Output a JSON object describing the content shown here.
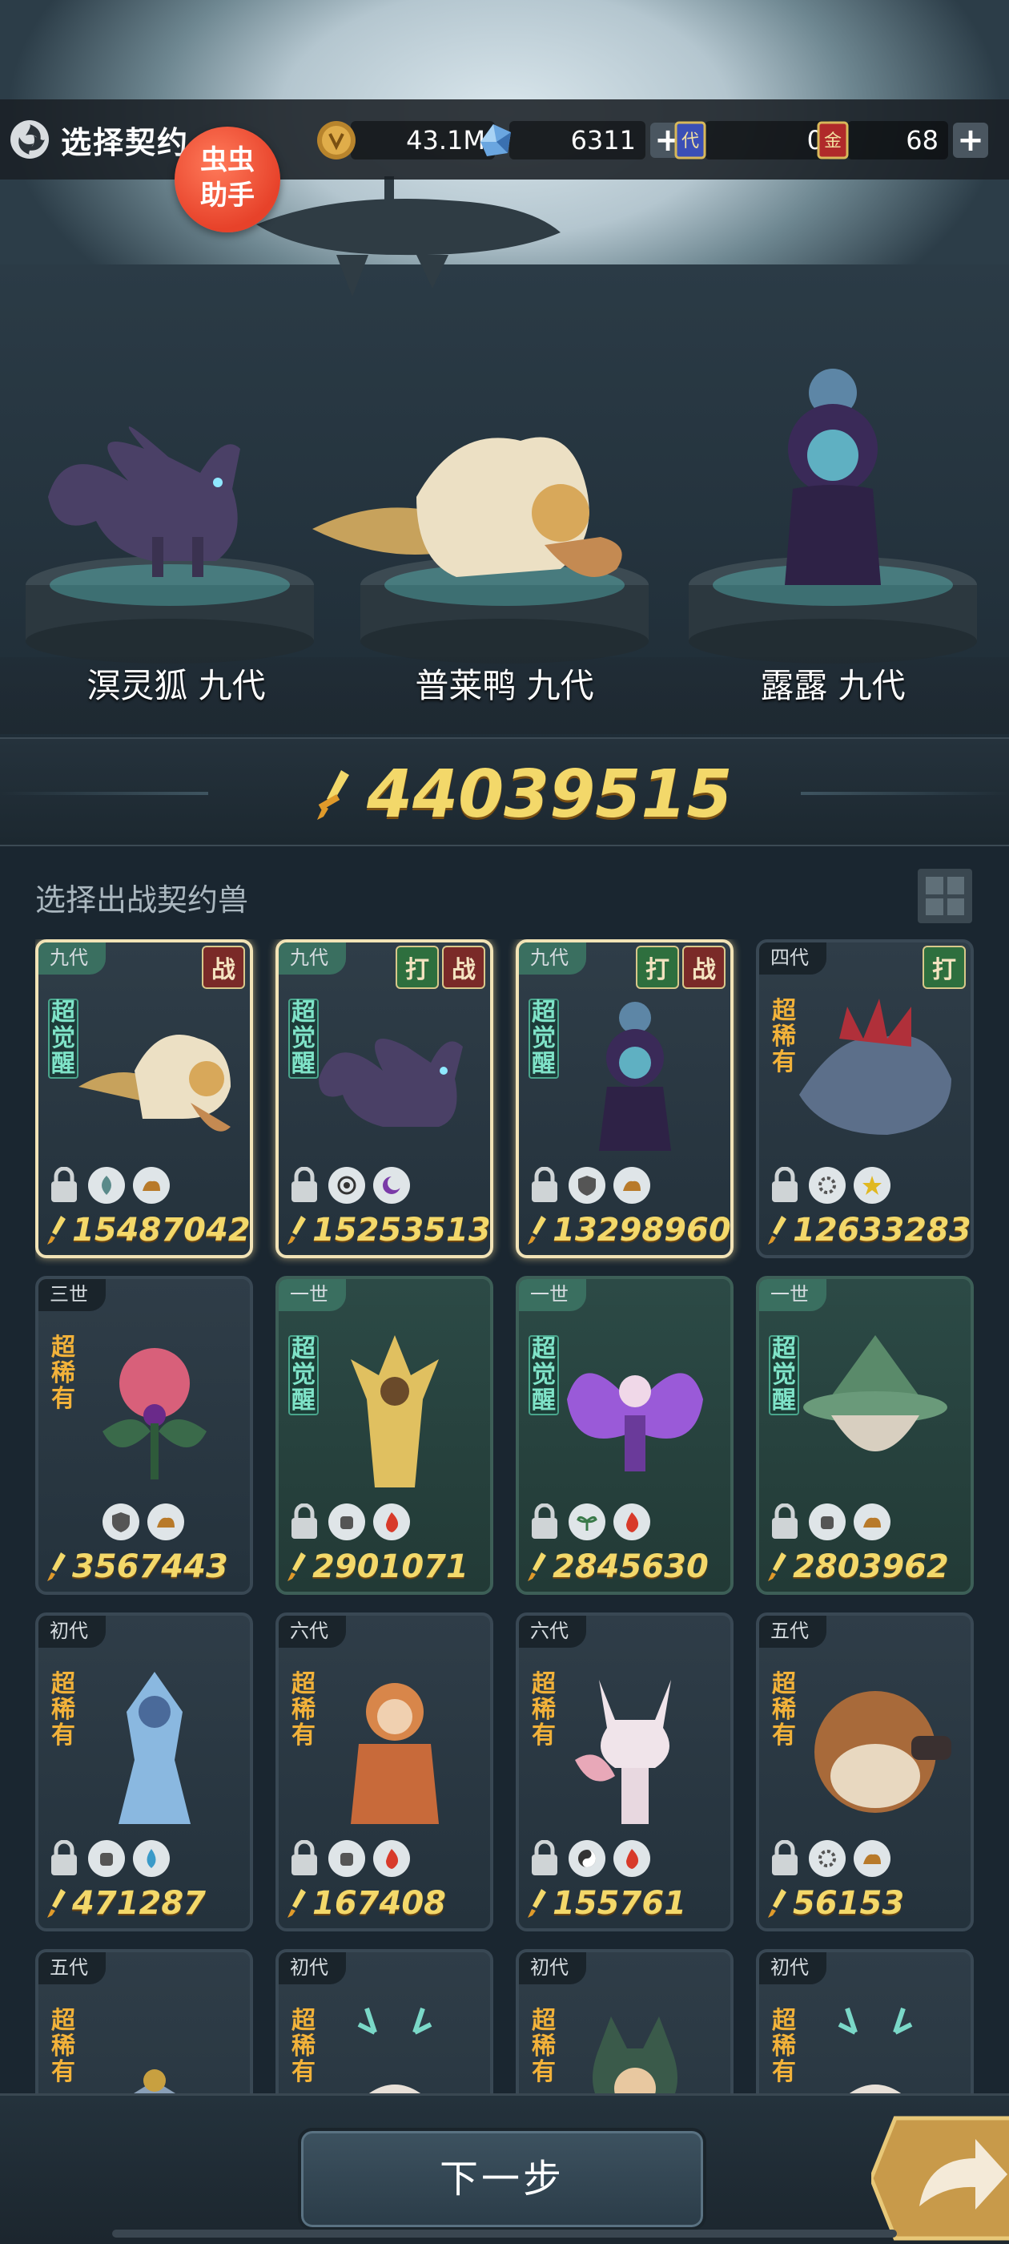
{
  "header": {
    "title": "选择契约",
    "app_badge": "虫虫\n助手",
    "app_badge_line1": "虫虫",
    "app_badge_line2": "助手",
    "resources": [
      {
        "name": "gold",
        "icon": "gold-coin-icon",
        "value": "43.1M"
      },
      {
        "name": "crystal",
        "icon": "blue-crystal-icon",
        "value": "6311"
      },
      {
        "name": "generation-ticket",
        "icon": "dai-ticket-icon",
        "value": "0"
      },
      {
        "name": "gold-ticket",
        "icon": "jin-ticket-icon",
        "value": "68"
      }
    ]
  },
  "team": {
    "pets": [
      {
        "name": "溟灵狐 九代"
      },
      {
        "name": "普莱鸭 九代"
      },
      {
        "name": "露露 九代"
      }
    ],
    "total_power": "44039515"
  },
  "list": {
    "title": "选择出战契约兽",
    "cards": [
      {
        "gen": "九代",
        "rarity": "超觉醒",
        "tags": [
          "战"
        ],
        "power": "15487042",
        "selected": true
      },
      {
        "gen": "九代",
        "rarity": "超觉醒",
        "tags": [
          "打",
          "战"
        ],
        "power": "15253513",
        "selected": true
      },
      {
        "gen": "九代",
        "rarity": "超觉醒",
        "tags": [
          "打",
          "战"
        ],
        "power": "13298960",
        "selected": true
      },
      {
        "gen": "四代",
        "rarity": "超稀有",
        "tags": [
          "打"
        ],
        "power": "12633283",
        "selected": false
      },
      {
        "gen": "三世",
        "rarity": "超稀有",
        "tags": [],
        "power": "3567443",
        "selected": false
      },
      {
        "gen": "一世",
        "rarity": "超觉醒",
        "tags": [],
        "power": "2901071",
        "selected": false
      },
      {
        "gen": "一世",
        "rarity": "超觉醒",
        "tags": [],
        "power": "2845630",
        "selected": false
      },
      {
        "gen": "一世",
        "rarity": "超觉醒",
        "tags": [],
        "power": "2803962",
        "selected": false
      },
      {
        "gen": "初代",
        "rarity": "超稀有",
        "tags": [],
        "power": "471287",
        "selected": false
      },
      {
        "gen": "六代",
        "rarity": "超稀有",
        "tags": [],
        "power": "167408",
        "selected": false
      },
      {
        "gen": "六代",
        "rarity": "超稀有",
        "tags": [],
        "power": "155761",
        "selected": false
      },
      {
        "gen": "五代",
        "rarity": "超稀有",
        "tags": [],
        "power": "56153",
        "selected": false
      },
      {
        "gen": "五代",
        "rarity": "超稀有",
        "tags": [],
        "power": "",
        "selected": false
      },
      {
        "gen": "初代",
        "rarity": "超稀有",
        "tags": [],
        "power": "",
        "selected": false
      },
      {
        "gen": "初代",
        "rarity": "超稀有",
        "tags": [],
        "power": "",
        "selected": false
      },
      {
        "gen": "初代",
        "rarity": "超稀有",
        "tags": [],
        "power": "",
        "selected": false
      }
    ]
  },
  "footer": {
    "next_label": "下一步"
  },
  "colors": {
    "power_gold": "#f3d86a",
    "awake_teal": "#7fe3c8",
    "rare_orange": "#f2b23a",
    "tag_red": "#7a2a28",
    "tag_green": "#2e6f3e"
  }
}
